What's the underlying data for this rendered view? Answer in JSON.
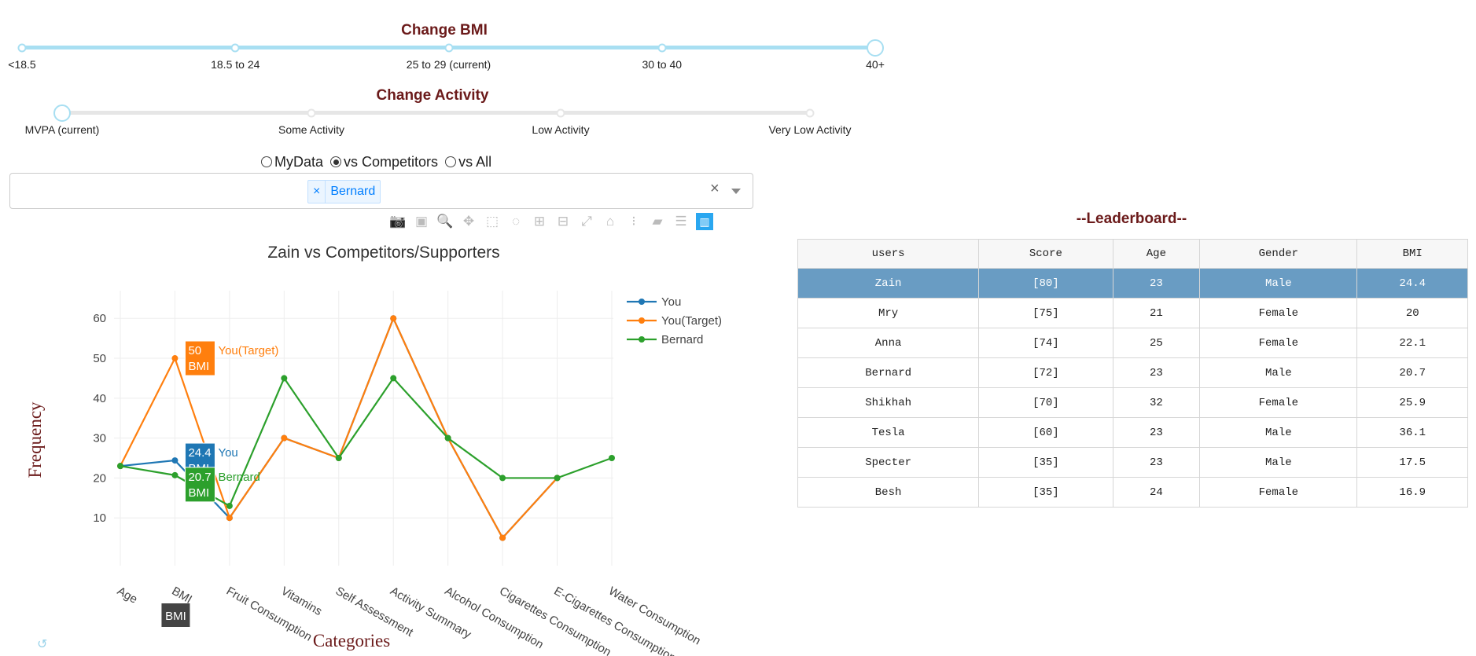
{
  "bmi_slider": {
    "title": "Change BMI",
    "ticks": [
      "<18.5",
      "18.5 to 24",
      "25 to 29 (current)",
      "30 to 40",
      "40+"
    ],
    "selected_index": 4,
    "color": "#a8dff2"
  },
  "activity_slider": {
    "title": "Change Activity",
    "ticks": [
      "MVPA (current)",
      "Some Activity",
      "Low Activity",
      "Very Low Activity"
    ],
    "selected_index": 0,
    "color": "#e6e6e6",
    "handle_color": "#a8dff2"
  },
  "compare_mode": {
    "options": [
      {
        "label": "MyData",
        "checked": false
      },
      {
        "label": "vs Competitors",
        "checked": true
      },
      {
        "label": "vs All",
        "checked": false
      }
    ]
  },
  "competitor_select": {
    "selected": [
      "Bernard"
    ],
    "chip_remove": "×",
    "clear": "×"
  },
  "toolbar": {
    "icons": [
      "camera-icon",
      "save-icon",
      "zoom-icon",
      "pan-icon",
      "box-select-icon",
      "lasso-select-icon",
      "zoom-in-icon",
      "zoom-out-icon",
      "autoscale-icon",
      "reset-axes-icon",
      "spike-lines-icon",
      "hover-closest-icon",
      "hover-compare-icon",
      "plotly-logo-icon"
    ]
  },
  "chart_data": {
    "type": "line",
    "title": "Zain vs Competitors/Supporters",
    "xlabel": "Categories",
    "ylabel": "Frequency",
    "ylim": [
      0,
      63
    ],
    "yticks": [
      10,
      20,
      30,
      40,
      50,
      60
    ],
    "grid": true,
    "legend_position": "top-right",
    "categories": [
      "Age",
      "BMI",
      "Fruit Consumption",
      "Vitamins",
      "Self Assessment",
      "Activity Summary",
      "Alcohol Consumption",
      "Cigarettes Consumption",
      "E-Cigarettes Consumption",
      "Water Consumption"
    ],
    "series": [
      {
        "name": "You",
        "color": "#1f77b4",
        "values": [
          23,
          24.4,
          10,
          30,
          25,
          60,
          30,
          5,
          20,
          null
        ]
      },
      {
        "name": "You(Target)",
        "color": "#ff7f0e",
        "values": [
          23,
          50,
          10,
          30,
          25,
          60,
          30,
          5,
          20,
          null
        ]
      },
      {
        "name": "Bernard",
        "color": "#2ca02c",
        "values": [
          23,
          20.7,
          13,
          45,
          25,
          45,
          30,
          20,
          20,
          25
        ]
      }
    ],
    "hover": {
      "category_index": 1,
      "axis_label": "BMI",
      "labels": [
        {
          "series": "You(Target)",
          "value": "50",
          "cat": "BMI",
          "name": "You(Target)"
        },
        {
          "series": "You",
          "value": "24.4",
          "cat": "BMI",
          "name": "You"
        },
        {
          "series": "Bernard",
          "value": "20.7",
          "cat": "BMI",
          "name": "Bernard"
        }
      ]
    }
  },
  "leaderboard": {
    "title": "--Leaderboard--",
    "headers": [
      "users",
      "Score",
      "Age",
      "Gender",
      "BMI"
    ],
    "rows": [
      [
        "Zain",
        "[80]",
        "23",
        "Male",
        "24.4"
      ],
      [
        "Mry",
        "[75]",
        "21",
        "Female",
        "20"
      ],
      [
        "Anna",
        "[74]",
        "25",
        "Female",
        "22.1"
      ],
      [
        "Bernard",
        "[72]",
        "23",
        "Male",
        "20.7"
      ],
      [
        "Shikhah",
        "[70]",
        "32",
        "Female",
        "25.9"
      ],
      [
        "Tesla",
        "[60]",
        "23",
        "Male",
        "36.1"
      ],
      [
        "Specter",
        "[35]",
        "23",
        "Male",
        "17.5"
      ],
      [
        "Besh",
        "[35]",
        "24",
        "Female",
        "16.9"
      ]
    ],
    "selected_row": 0,
    "selected_color": "#699cc3"
  }
}
